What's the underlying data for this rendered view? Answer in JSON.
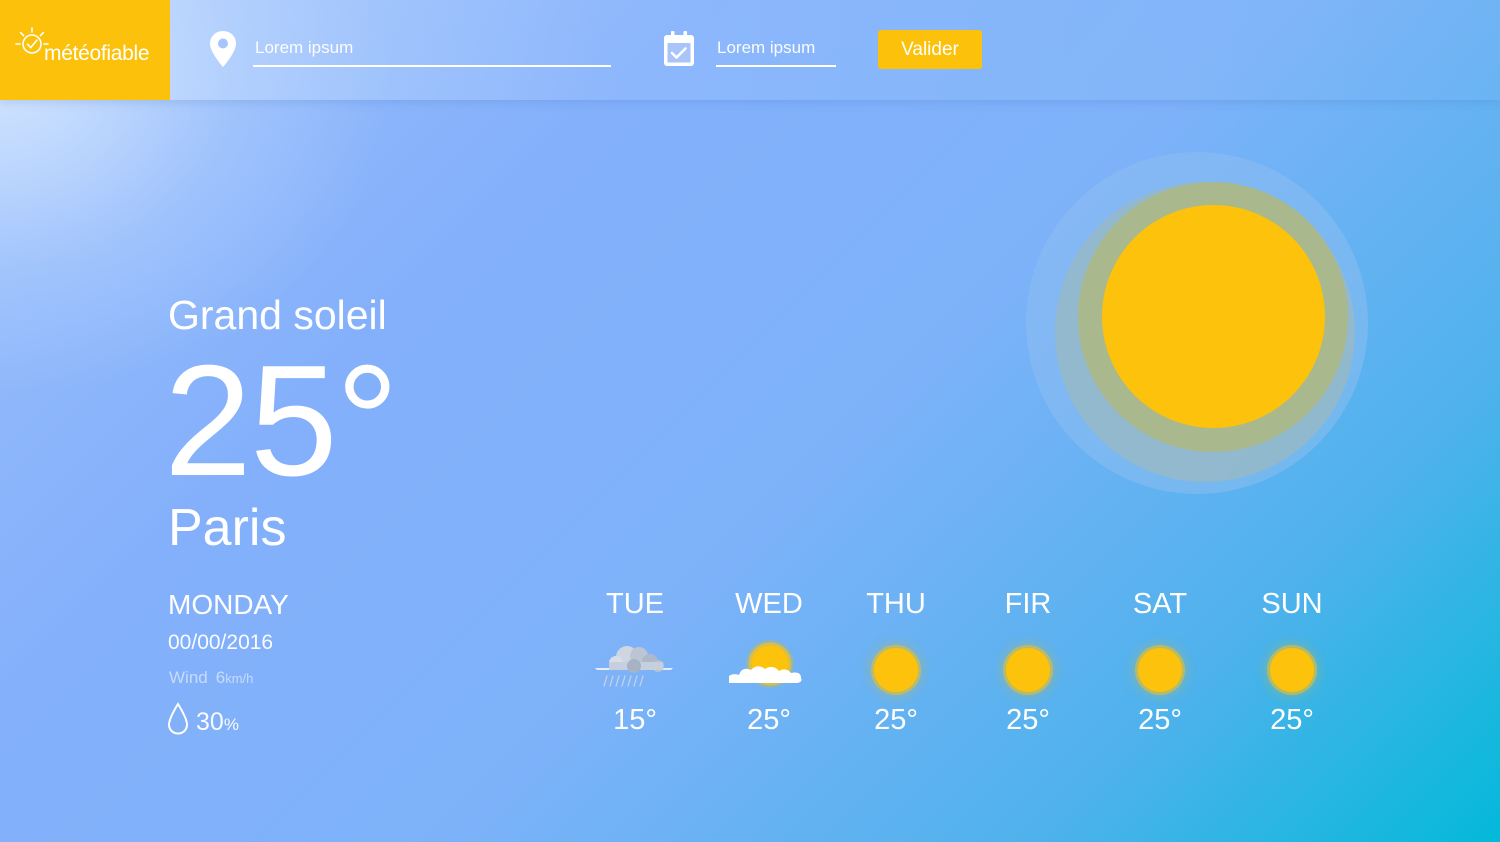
{
  "brand": {
    "name_light": "météo",
    "name_bold": "fiable"
  },
  "search": {
    "location_placeholder": "Lorem ipsum",
    "date_placeholder": "Lorem ipsum",
    "submit_label": "Valider"
  },
  "current": {
    "condition": "Grand soleil",
    "temperature": "25°",
    "city": "Paris",
    "day": "MONDAY",
    "date": "00/00/2016",
    "wind_label": "Wind",
    "wind_value": "6",
    "wind_unit": "km/h",
    "humidity_value": "30",
    "humidity_unit": "%"
  },
  "forecast": [
    {
      "day": "TUE",
      "temp": "15°",
      "icon": "rain-cloud-icon"
    },
    {
      "day": "WED",
      "temp": "25°",
      "icon": "sun-cloud-icon"
    },
    {
      "day": "THU",
      "temp": "25°",
      "icon": "sun-icon"
    },
    {
      "day": "FIR",
      "temp": "25°",
      "icon": "sun-icon"
    },
    {
      "day": "SAT",
      "temp": "25°",
      "icon": "sun-icon"
    },
    {
      "day": "SUN",
      "temp": "25°",
      "icon": "sun-icon"
    }
  ],
  "colors": {
    "accent": "#fcc10a",
    "background_start": "#9cc1fb",
    "background_end": "#03b9d9",
    "text": "#ffffff"
  }
}
